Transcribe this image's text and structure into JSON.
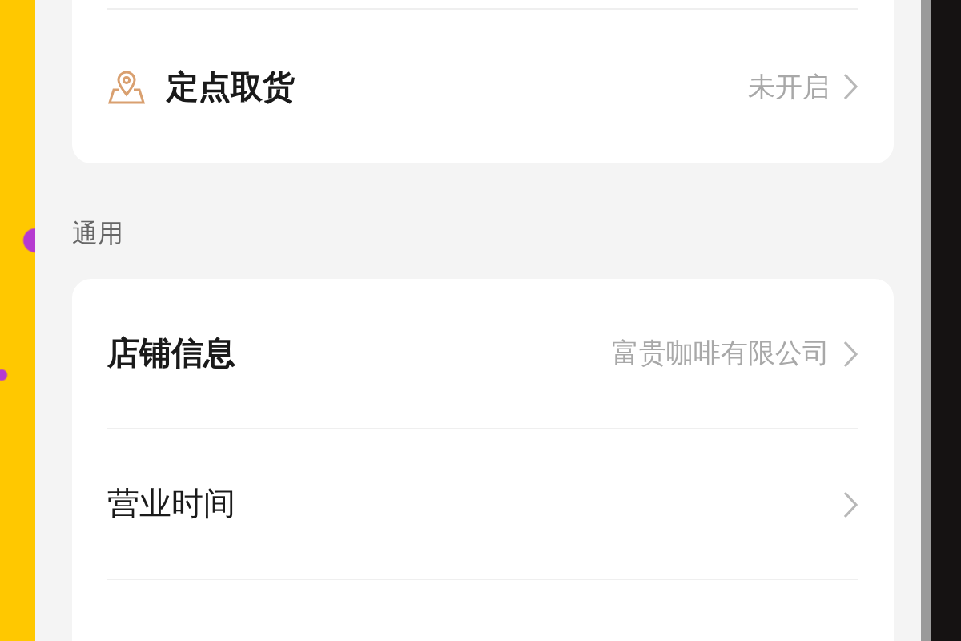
{
  "sections": [
    {
      "rows": [
        {
          "kind": "location",
          "label": "定点取货",
          "bold": true,
          "value": "未开启"
        }
      ]
    },
    {
      "title": "通用",
      "rows": [
        {
          "label": "店铺信息",
          "bold": true,
          "value": "富贵咖啡有限公司"
        },
        {
          "label": "营业时间",
          "bold": false
        }
      ]
    }
  ]
}
